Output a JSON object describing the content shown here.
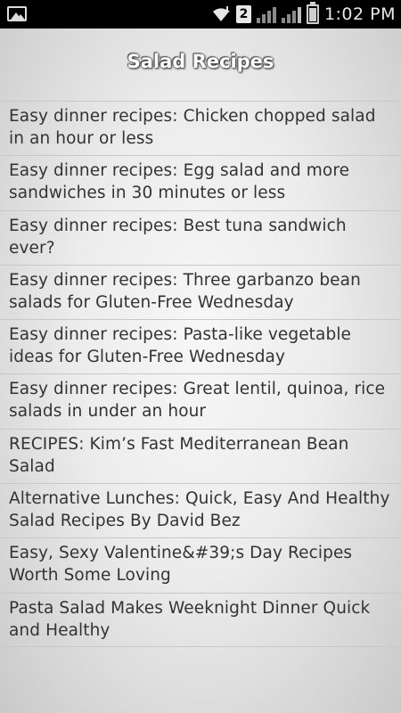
{
  "status_bar": {
    "sim_number": "2",
    "time": "1:02 PM"
  },
  "header": {
    "title": "Salad Recipes"
  },
  "recipes": [
    "Easy dinner recipes: Chicken chopped salad in an hour or less",
    "Easy dinner recipes: Egg salad and more sandwiches in 30 minutes or less",
    "Easy dinner recipes: Best tuna sandwich ever?",
    "Easy dinner recipes: Three garbanzo bean salads for Gluten-Free Wednesday",
    "Easy dinner recipes: Pasta-like vegetable ideas for Gluten-Free Wednesday",
    "Easy dinner recipes: Great lentil, quinoa, rice salads in under an hour",
    "RECIPES: Kim’s Fast Mediterranean Bean Salad",
    "Alternative Lunches: Quick, Easy And Healthy Salad Recipes By David Bez",
    "Easy, Sexy Valentine&#39;s Day Recipes Worth Some Loving",
    "Pasta Salad Makes Weeknight Dinner Quick and Healthy"
  ]
}
